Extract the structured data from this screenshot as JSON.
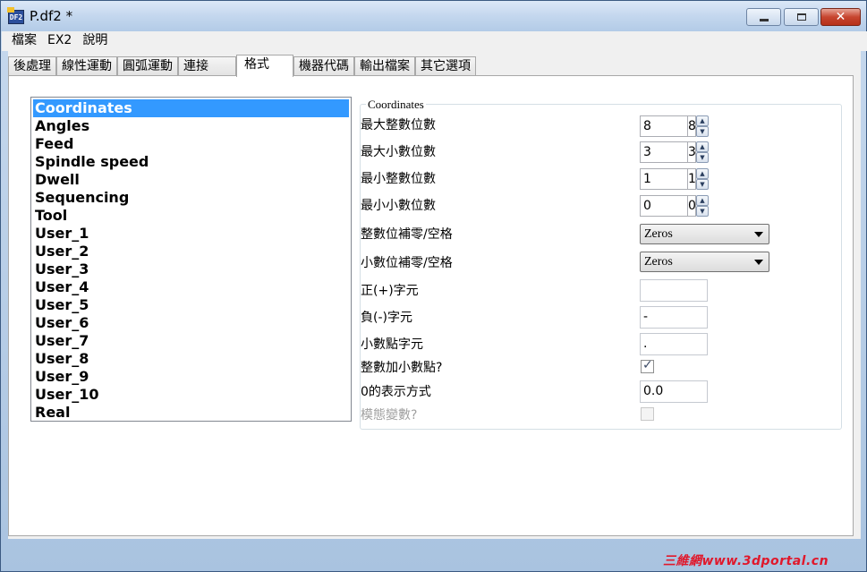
{
  "window": {
    "title": "P.df2 *",
    "app_icon_text": "DF2"
  },
  "menu": [
    "檔案",
    "EX2",
    "說明"
  ],
  "tabs": [
    "後處理",
    "線性運動",
    "圓弧運動",
    "連接",
    "格式",
    "機器代碼",
    "輸出檔案",
    "其它選項"
  ],
  "active_tab": "格式",
  "list": {
    "selected": "Coordinates",
    "items": [
      "Coordinates",
      "Angles",
      "Feed",
      "Spindle speed",
      "Dwell",
      "Sequencing",
      "Tool",
      "User_1",
      "User_2",
      "User_3",
      "User_4",
      "User_5",
      "User_6",
      "User_7",
      "User_8",
      "User_9",
      "User_10",
      "Real"
    ]
  },
  "group": {
    "title": "Coordinates",
    "max_int_digits": {
      "label": "最大整數位數",
      "value": "8",
      "clipped": "8"
    },
    "max_dec_digits": {
      "label": "最大小數位數",
      "value": "3",
      "clipped": "3"
    },
    "min_int_digits": {
      "label": "最小整數位數",
      "value": "1",
      "clipped": "1"
    },
    "min_dec_digits": {
      "label": "最小小數位數",
      "value": "0",
      "clipped": "0"
    },
    "int_pad": {
      "label": "整數位補零/空格",
      "value": "Zeros"
    },
    "dec_pad": {
      "label": "小數位補零/空格",
      "value": "Zeros"
    },
    "plus_char": {
      "label": "正(+)字元",
      "value": ""
    },
    "minus_char": {
      "label": "負(-)字元",
      "value": "-"
    },
    "decimal_char": {
      "label": "小數點字元",
      "value": "."
    },
    "int_add_decimal": {
      "label": "整數加小數點?",
      "checked": true
    },
    "zero_format": {
      "label": "0的表示方式",
      "value": "0.0"
    },
    "modal_var": {
      "label": "模態變數?",
      "checked": false,
      "disabled": true
    }
  },
  "watermark": "三維網www.3dportal.cn"
}
